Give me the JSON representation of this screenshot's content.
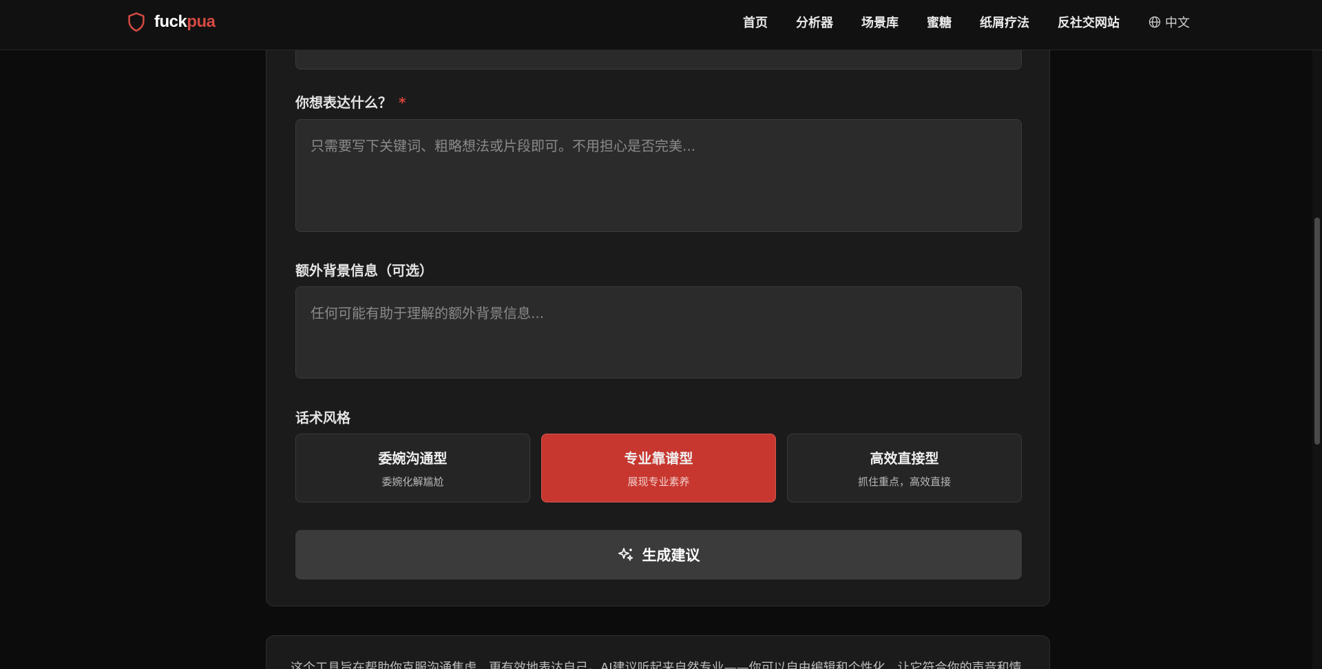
{
  "header": {
    "brand_a": "fuck",
    "brand_b": "pua",
    "nav": [
      "首页",
      "分析器",
      "场景库",
      "蜜糖",
      "纸屑疗法",
      "反社交网站"
    ],
    "language": "中文"
  },
  "form": {
    "express_label": "你想表达什么？",
    "required_mark": "*",
    "express_placeholder": "只需要写下关键词、粗略想法或片段即可。不用担心是否完美...",
    "context_label": "额外背景信息（可选）",
    "context_placeholder": "任何可能有助于理解的额外背景信息...",
    "style_label": "话术风格",
    "styles": [
      {
        "title": "委婉沟通型",
        "subtitle": "委婉化解尴尬"
      },
      {
        "title": "专业靠谱型",
        "subtitle": "展现专业素养"
      },
      {
        "title": "高效直接型",
        "subtitle": "抓住重点，高效直接"
      }
    ],
    "selected_style": "专业靠谱型",
    "generate_label": "生成建议"
  },
  "note": {
    "text": "这个工具旨在帮助你克服沟通焦虑，更有效地表达自己。AI建议听起来自然专业——你可以自由编辑和个性化，让它符合你的声音和情"
  },
  "colors": {
    "accent": "#c7372f",
    "background": "#0c0c0c",
    "card": "#1b1b1b"
  }
}
